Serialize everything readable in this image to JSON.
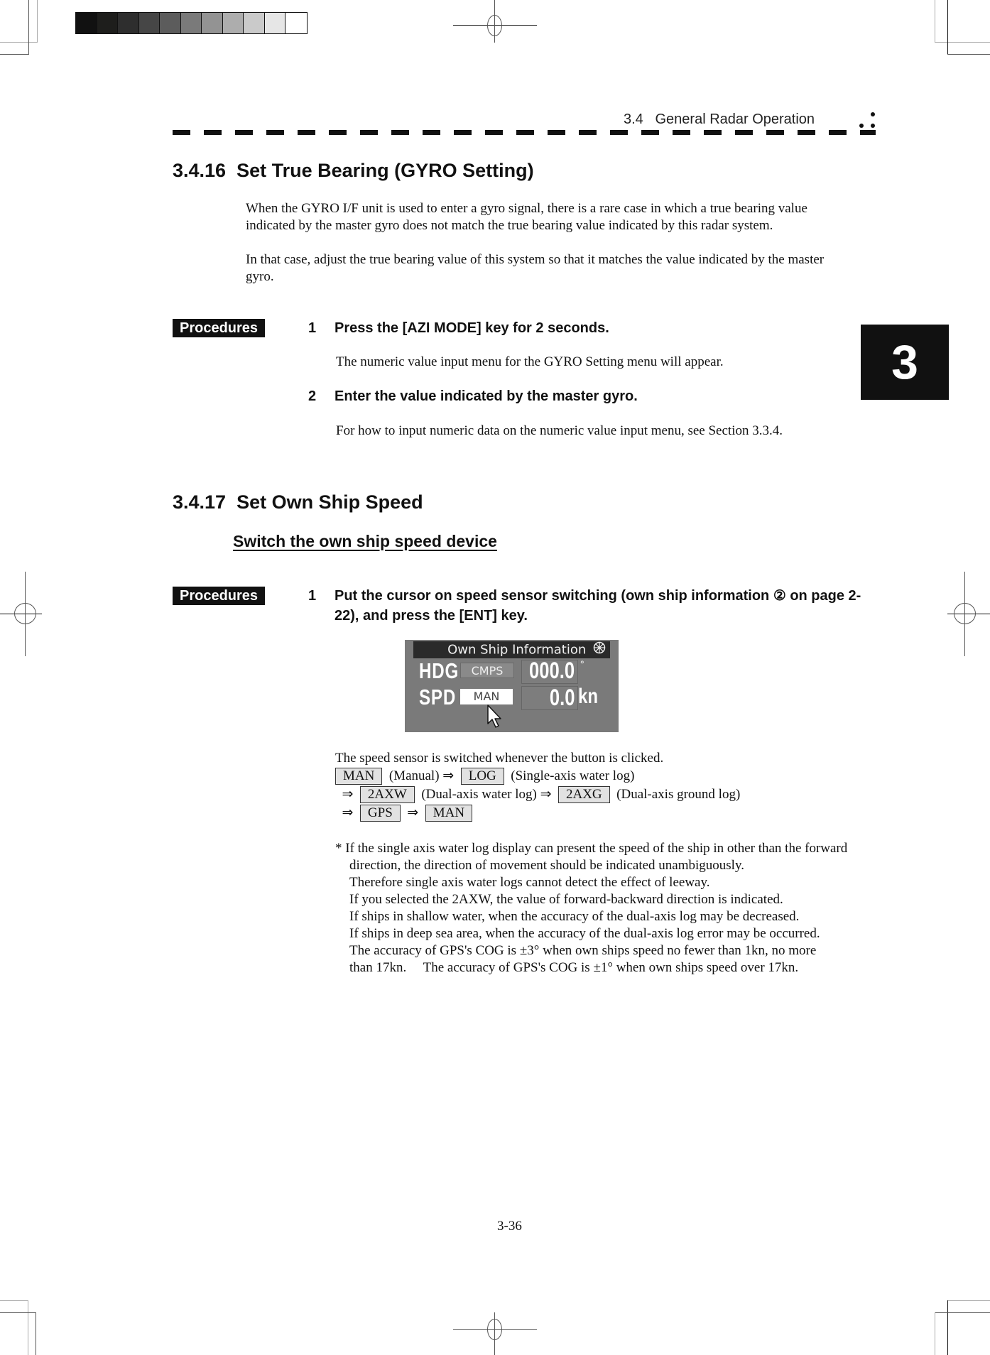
{
  "header": {
    "section_number": "3.4",
    "section_title": "General Radar Operation"
  },
  "chapter_tab": "3",
  "color_bar": [
    "#111111",
    "#1e1e1c",
    "#2e2e2e",
    "#464646",
    "#5c5c5c",
    "#7a7a7a",
    "#939393",
    "#adadad",
    "#cacaca",
    "#e6e6e6",
    "#ffffff"
  ],
  "section_3_4_16": {
    "number": "3.4.16",
    "title": "Set True Bearing (GYRO Setting)",
    "intro": [
      "When the GYRO I/F unit is used to enter a gyro signal, there is a rare case in which a true bearing value indicated by the master gyro does not match the true bearing value indicated by this radar system.",
      "In that case, adjust the true bearing value of this system so that it matches the value indicated by the master gyro."
    ],
    "procedures_label": "Procedures",
    "steps": [
      {
        "number": "1",
        "instruction": "Press the [AZI MODE] key for 2 seconds.",
        "detail": "The numeric value input menu for the GYRO Setting menu will appear."
      },
      {
        "number": "2",
        "instruction": "Enter the value indicated by the master gyro.",
        "detail": "For how to input numeric data on the numeric value input menu, see Section 3.3.4."
      }
    ]
  },
  "section_3_4_17": {
    "number": "3.4.17",
    "title": "Set Own Ship Speed",
    "subheading": "Switch the own ship speed device",
    "procedures_label": "Procedures",
    "steps": [
      {
        "number": "1",
        "instruction": "Put the cursor on speed sensor switching (own ship information ② on page 2-22), and press the [ENT] key."
      }
    ],
    "own_ship_panel": {
      "title": "Own Ship Information",
      "title_icon": "compass-wheel-icon",
      "hdg_label": "HDG",
      "hdg_source": "CMPS",
      "hdg_value": "000.0",
      "hdg_unit": "°",
      "spd_label": "SPD",
      "spd_source": "MAN",
      "spd_value": "0.0",
      "spd_unit": "kn"
    },
    "switch_note": "The speed sensor is switched whenever the button is clicked.",
    "sequence": {
      "arrow": "⇒",
      "items": [
        {
          "key": "MAN",
          "desc": "(Manual)"
        },
        {
          "key": "LOG",
          "desc": "(Single-axis water log)"
        },
        {
          "key": "2AXW",
          "desc": "(Dual-axis water log)"
        },
        {
          "key": "2AXG",
          "desc": "(Dual-axis ground log)"
        },
        {
          "key": "GPS",
          "desc": ""
        },
        {
          "key": "MAN",
          "desc": ""
        }
      ]
    },
    "footnote": {
      "marker": "*",
      "lines": [
        "If the single axis water log display can present the speed of the ship in other than the forward direction, the direction of movement should be indicated unambiguously.",
        "Therefore single axis water logs cannot detect the effect of leeway.",
        "If you selected the 2AXW, the value of forward-backward direction is indicated.",
        "If ships in shallow water, when the accuracy of the dual-axis log may be decreased.",
        "If ships in deep sea area, when the accuracy of the dual-axis log error may be occurred.",
        "The accuracy of GPS's COG is ±3° when own ships speed no fewer than 1kn, no more than 17kn.　 The accuracy of GPS's COG is ±1° when own ships speed over 17kn."
      ]
    }
  },
  "page_number": "3-36"
}
